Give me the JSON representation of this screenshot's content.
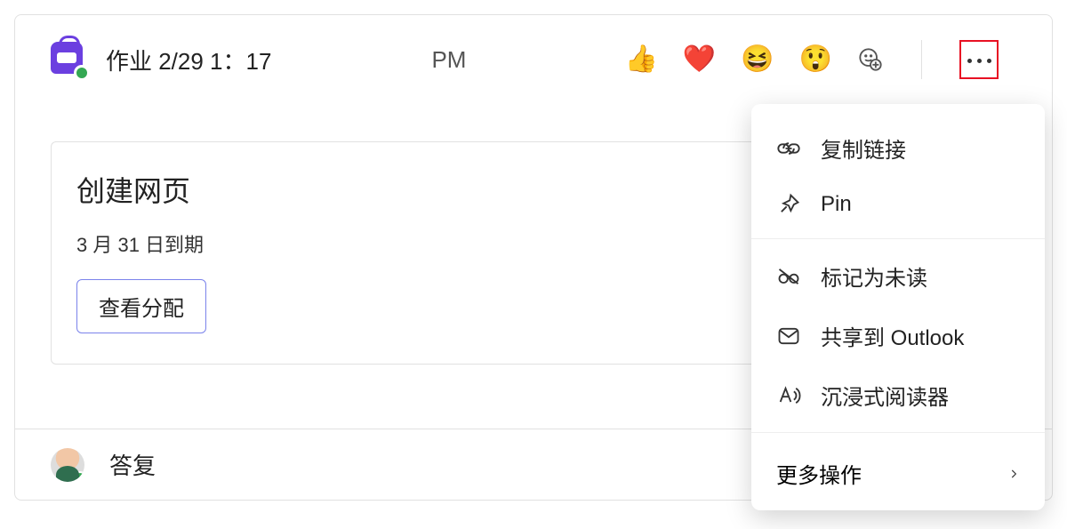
{
  "header": {
    "title": "作业 2/29 1：17",
    "ampm": "PM"
  },
  "reactions": {
    "like": "👍",
    "heart": "❤️",
    "laugh": "😆",
    "surprised": "😲"
  },
  "assignment": {
    "title": "创建网页",
    "due": "3 月 31 日到期",
    "view": "查看分配"
  },
  "reply": {
    "label": "答复"
  },
  "menu": {
    "copy": "复制链接",
    "pin": "Pin",
    "unread": "标记为未读",
    "outlook": "共享到 Outlook",
    "reader": "沉浸式阅读器",
    "more": "更多操作"
  }
}
